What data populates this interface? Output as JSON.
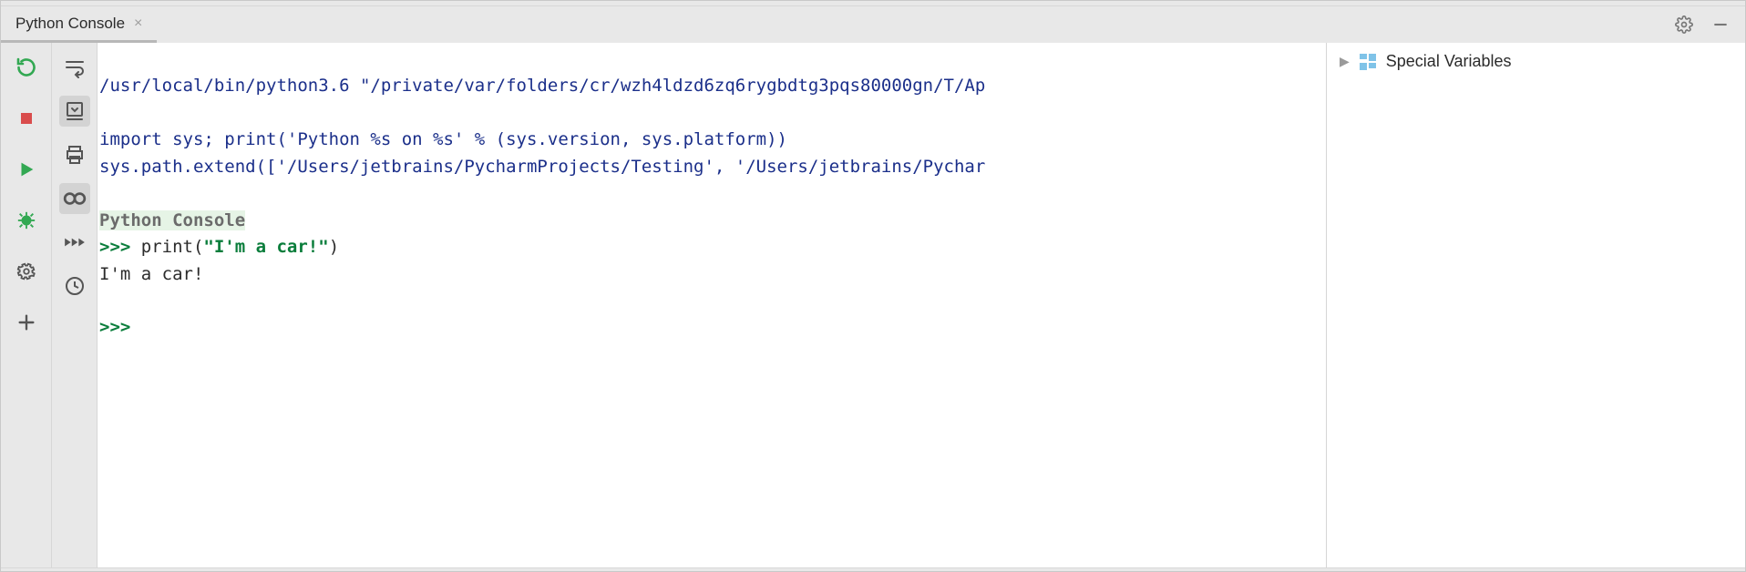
{
  "header": {
    "tab_label": "Python Console"
  },
  "console": {
    "line1": "/usr/local/bin/python3.6 \"/private/var/folders/cr/wzh4ldzd6zq6rygbdtg3pqs80000gn/T/Ap",
    "line_import": "import sys; print('Python %s on %s' % (sys.version, sys.platform))",
    "line_extend": "sys.path.extend(['/Users/jetbrains/PycharmProjects/Testing', '/Users/jetbrains/Pychar",
    "banner": "Python Console",
    "prompt": ">>> ",
    "call": "print(",
    "string": "\"I'm a car!\"",
    "callend": ")",
    "output": "I'm a car!",
    "prompt2": ">>> "
  },
  "variables": {
    "title": "Special Variables"
  }
}
